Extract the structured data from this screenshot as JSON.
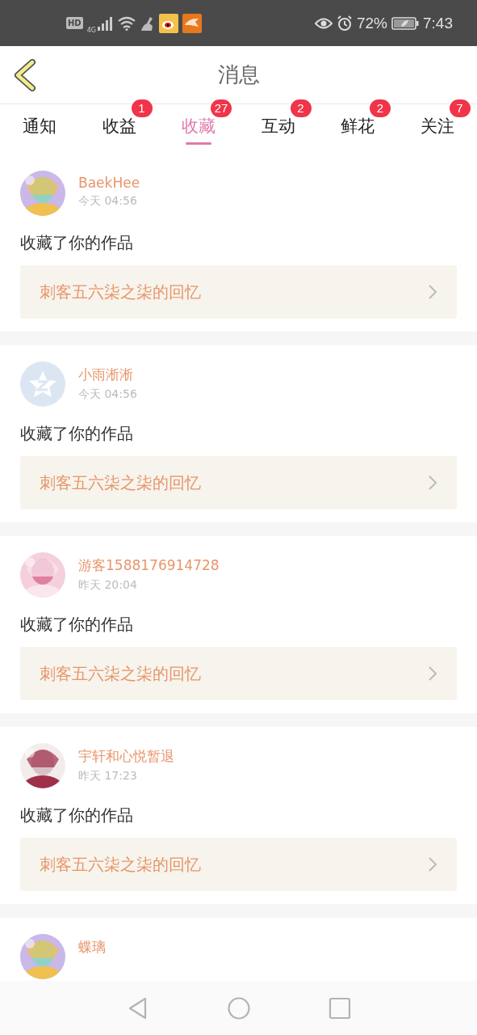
{
  "status_bar": {
    "network": "HD",
    "cellular": "4G",
    "battery": "72%",
    "time": "7:43"
  },
  "header": {
    "title": "消息"
  },
  "tabs": [
    {
      "label": "通知",
      "selected": false
    },
    {
      "label": "收益",
      "selected": false,
      "badge": "1"
    },
    {
      "label": "收藏",
      "selected": true,
      "badge": "27"
    },
    {
      "label": "互动",
      "selected": false,
      "badge": "2"
    },
    {
      "label": "鲜花",
      "selected": false,
      "badge": "2"
    },
    {
      "label": "关注",
      "selected": false,
      "badge": "7"
    }
  ],
  "messages": [
    {
      "name": "BaekHee",
      "time": "今天 04:56",
      "text": "收藏了你的作品",
      "work": "刺客五六柒之柒的回忆"
    },
    {
      "avatar": {
        "kind": "default"
      },
      "name": "小雨淅淅",
      "time": "今天 04:56",
      "text": "收藏了你的作品",
      "work": "刺客五六柒之柒的回忆"
    },
    {
      "name": "游客1588176914728",
      "time": "昨天 20:04",
      "text": "收藏了你的作品",
      "work": "刺客五六柒之柒的回忆"
    },
    {
      "name": "宇轩和心悦暂退",
      "time": "昨天 17:23",
      "text": "收藏了你的作品",
      "work": "刺客五六柒之柒的回忆"
    },
    {
      "name": "蝶璃"
    }
  ]
}
